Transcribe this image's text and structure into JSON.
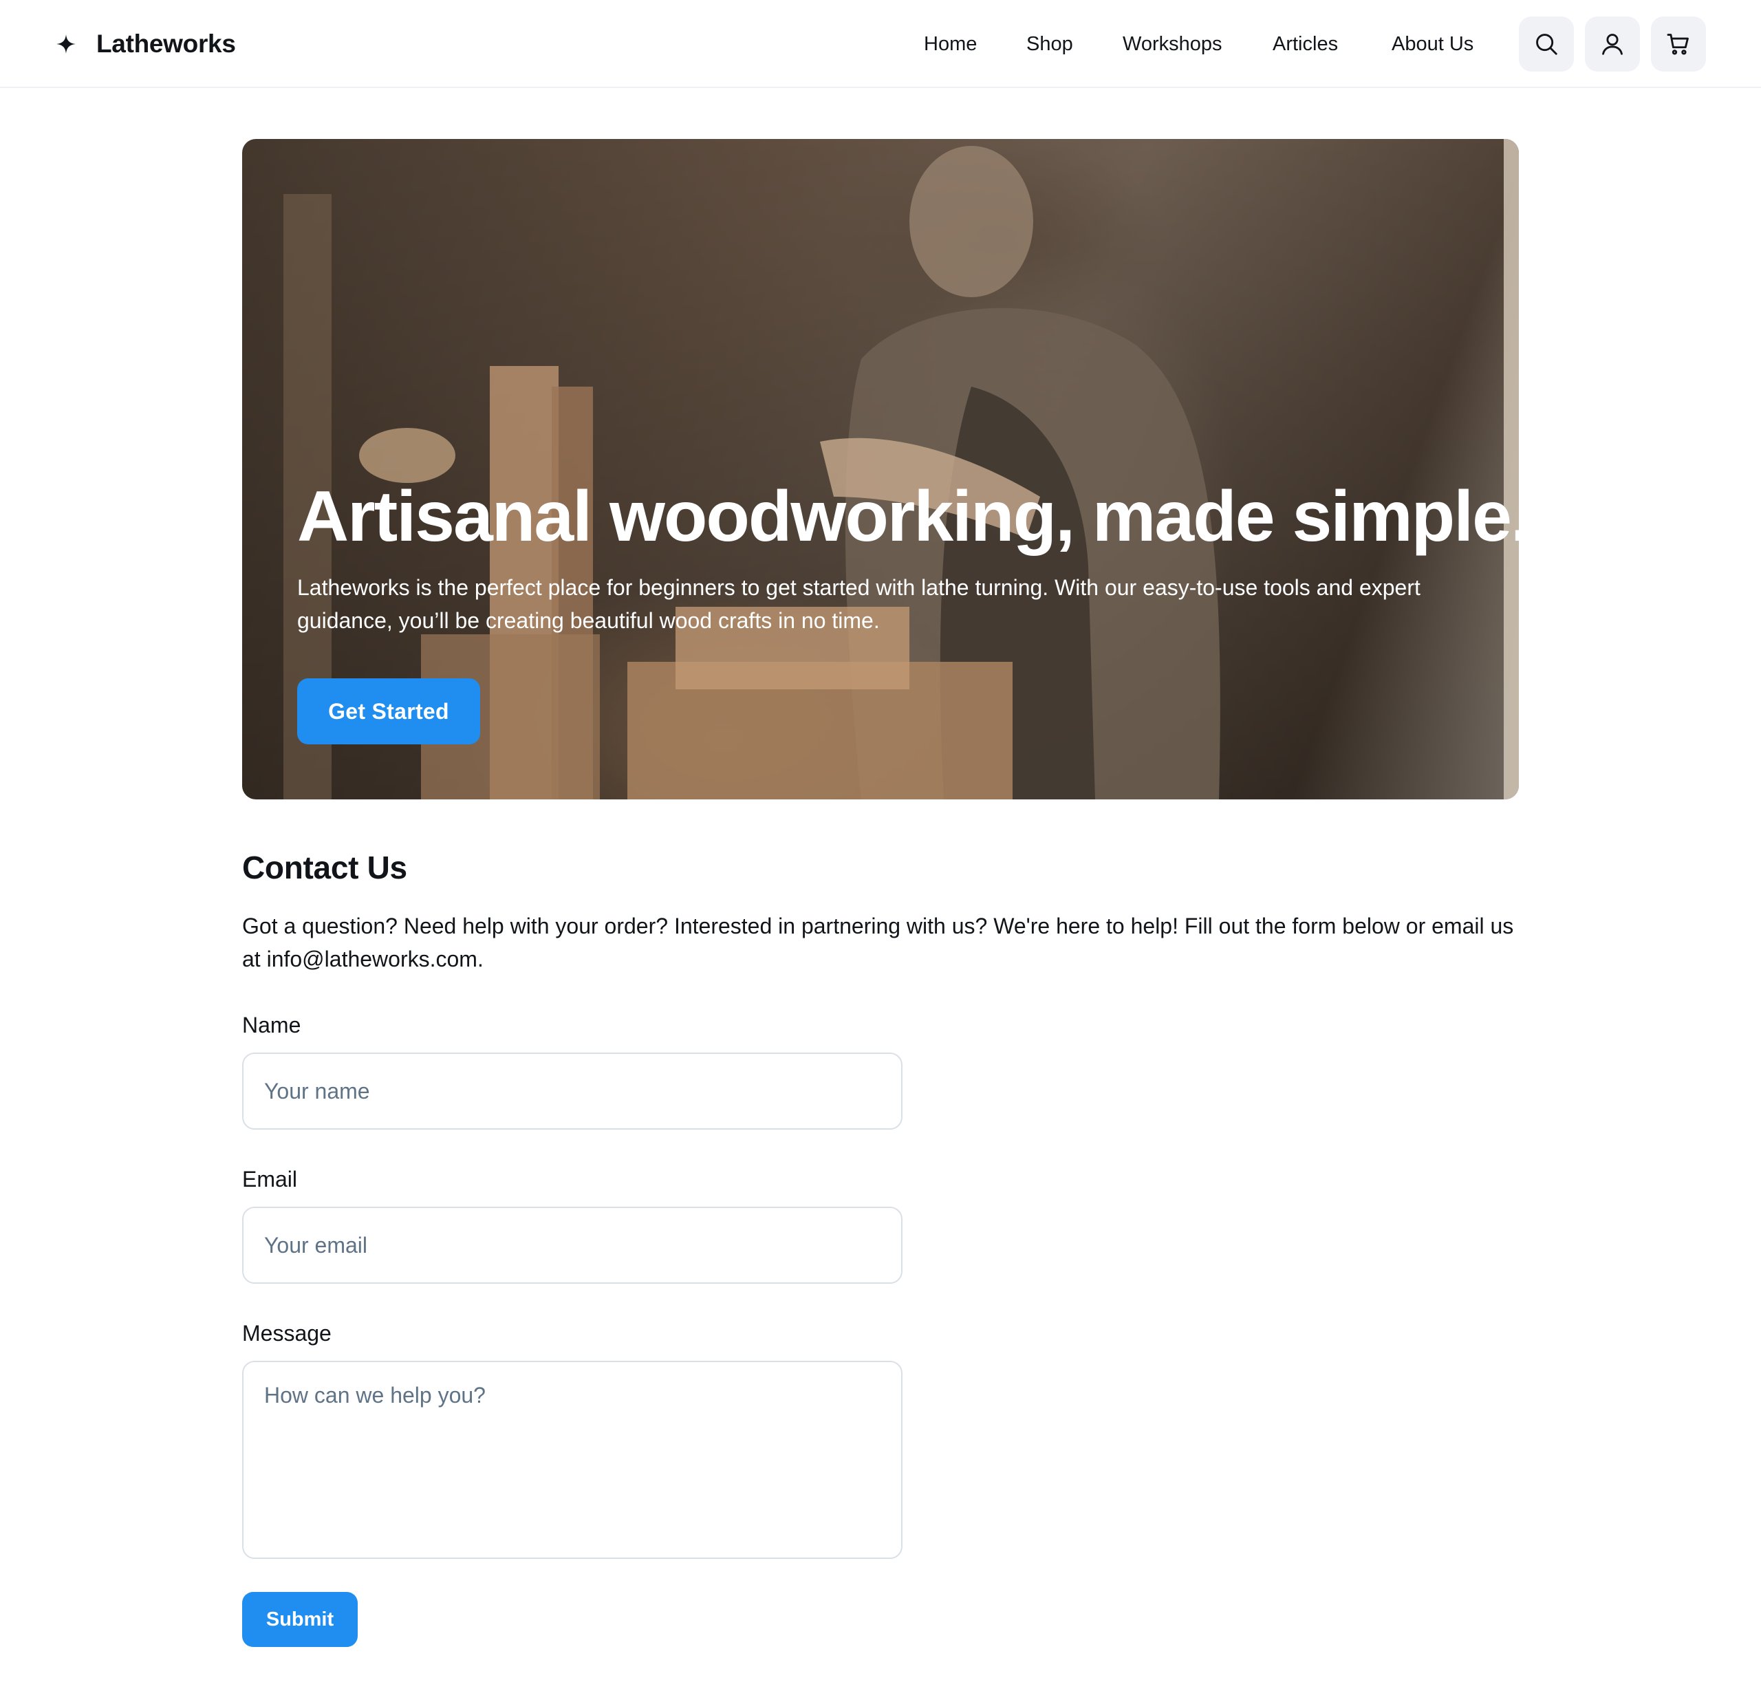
{
  "header": {
    "brand_name": "Latheworks",
    "nav": [
      {
        "label": "Home"
      },
      {
        "label": "Shop"
      },
      {
        "label": "Workshops"
      },
      {
        "label": "Articles"
      },
      {
        "label": "About Us"
      }
    ],
    "icons": [
      "search-icon",
      "user-icon",
      "cart-icon"
    ]
  },
  "hero": {
    "title": "Artisanal woodworking, made simple.",
    "subtitle": "Latheworks is the perfect place for beginners to get started with lathe turning. With our easy-to-use tools and expert guidance, you’ll be creating beautiful wood crafts in no time.",
    "cta_label": "Get Started"
  },
  "contact": {
    "title": "Contact Us",
    "description": "Got a question? Need help with your order? Interested in partnering with us? We're here to help! Fill out the form below or email us at info@latheworks.com.",
    "fields": {
      "name": {
        "label": "Name",
        "placeholder": "Your name",
        "value": ""
      },
      "email": {
        "label": "Email",
        "placeholder": "Your email",
        "value": ""
      },
      "message": {
        "label": "Message",
        "placeholder": "How can we help you?",
        "value": ""
      }
    },
    "submit_label": "Submit"
  },
  "colors": {
    "accent": "#1f8ef0",
    "text": "#111418",
    "placeholder": "#5f7387",
    "border": "#dbe0e6",
    "icon_button_bg": "#f0f2f5"
  }
}
